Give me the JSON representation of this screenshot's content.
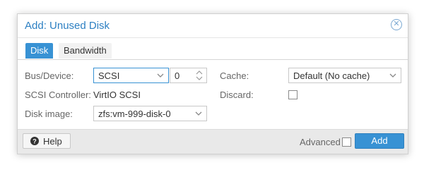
{
  "dialog": {
    "title": "Add: Unused Disk",
    "close_icon": "close-circle-icon"
  },
  "tabs": [
    {
      "label": "Disk",
      "active": true
    },
    {
      "label": "Bandwidth",
      "active": false
    }
  ],
  "form": {
    "bus_device_label": "Bus/Device:",
    "bus_value": "SCSI",
    "device_number": "0",
    "scsi_controller_label": "SCSI Controller:",
    "scsi_controller_value": "VirtIO SCSI",
    "disk_image_label": "Disk image:",
    "disk_image_value": "zfs:vm-999-disk-0",
    "cache_label": "Cache:",
    "cache_value": "Default (No cache)",
    "discard_label": "Discard:",
    "discard_checked": false
  },
  "footer": {
    "help_label": "Help",
    "help_icon": "question-circle-icon",
    "advanced_label": "Advanced",
    "advanced_checked": false,
    "add_label": "Add"
  },
  "colors": {
    "accent": "#3892d4",
    "title": "#2c7fc2"
  }
}
